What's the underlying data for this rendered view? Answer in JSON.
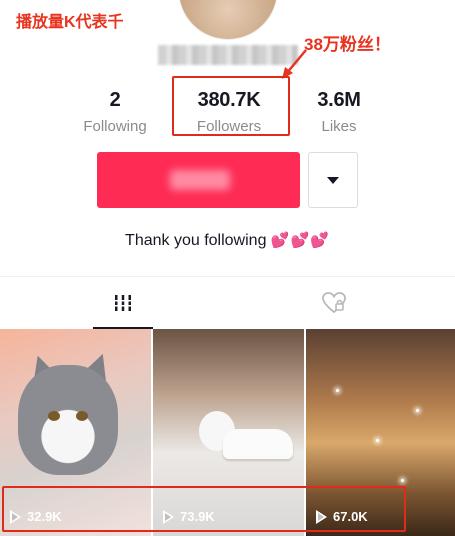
{
  "overlay": {
    "title": "播放量K代表千",
    "note": "38万粉丝！"
  },
  "stats": [
    {
      "value": "2",
      "label": "Following"
    },
    {
      "value": "380.7K",
      "label": "Followers"
    },
    {
      "value": "3.6M",
      "label": "Likes"
    }
  ],
  "bio": {
    "text": "Thank you following",
    "hearts": "💕💕💕"
  },
  "tabs": [
    {
      "icon": "grid-icon"
    },
    {
      "icon": "liked-heart-icon"
    }
  ],
  "videos": [
    {
      "views": "32.9K"
    },
    {
      "views": "73.9K"
    },
    {
      "views": "67.0K"
    }
  ],
  "colors": {
    "follow_button": "#fe2c55",
    "annotation_red": "#e8341f"
  }
}
